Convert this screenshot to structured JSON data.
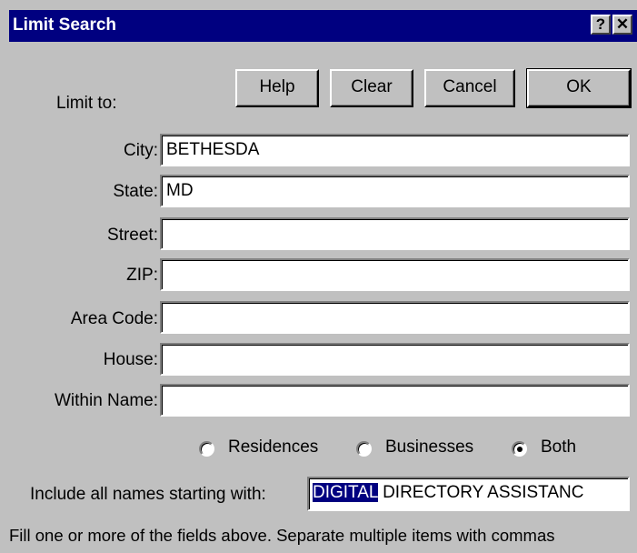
{
  "window": {
    "title": "Limit Search",
    "help_glyph": "?",
    "close_glyph": "✕"
  },
  "buttons": {
    "help": "Help",
    "clear": "Clear",
    "cancel": "Cancel",
    "ok": "OK"
  },
  "limit_to_label": "Limit to:",
  "fields": [
    {
      "label": "City:",
      "value": "BETHESDA"
    },
    {
      "label": "State:",
      "value": "MD"
    },
    {
      "label": "Street:",
      "value": ""
    },
    {
      "label": "ZIP:",
      "value": ""
    },
    {
      "label": "Area Code:",
      "value": ""
    },
    {
      "label": "House:",
      "value": ""
    },
    {
      "label": "Within Name:",
      "value": ""
    }
  ],
  "radio_options": {
    "residences": "Residences",
    "businesses": "Businesses",
    "both": "Both",
    "selected": "Both"
  },
  "include_label": "Include all names starting with:",
  "include_value_selected": "DIGITAL",
  "include_value_rest": " DIRECTORY ASSISTANC",
  "footer_text": "Fill one or more of the fields above. Separate multiple items with commas",
  "colors": {
    "titlebar": "#000080",
    "dialog_bg": "#c0c0c0",
    "selection": "#000080"
  }
}
